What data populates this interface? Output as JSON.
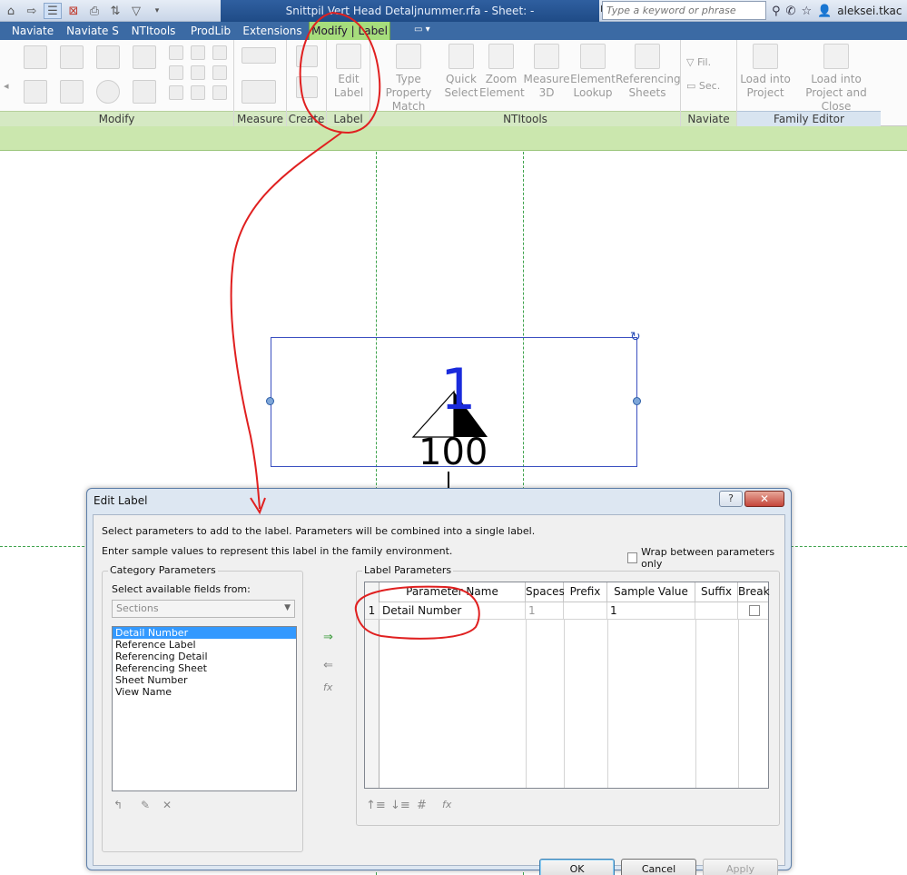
{
  "title_bar": {
    "doc_title": "Snittpil Vert Head Detaljnummer.rfa - Sheet: -",
    "search_placeholder": "Type a keyword or phrase",
    "username": "aleksei.tkac",
    "icons": [
      "home-icon",
      "forward-icon",
      "active-view-icon",
      "close-windows-icon",
      "print-icon",
      "sync-icon",
      "filter-icon",
      "dropdown-icon",
      "binoculars-icon",
      "satellite-icon",
      "star-icon",
      "user-icon"
    ]
  },
  "tabs": [
    {
      "label": "Naviate"
    },
    {
      "label": "Naviate S"
    },
    {
      "label": "NTItools"
    },
    {
      "label": "ProdLib"
    },
    {
      "label": "Extensions"
    },
    {
      "label": "Modify | Label"
    }
  ],
  "ribbon": {
    "panels": {
      "modify": "Modify",
      "measure": "Measure",
      "create": "Create",
      "label": "Label",
      "ntitools": "NTItools",
      "naviate": "Naviate",
      "family_editor": "Family Editor"
    },
    "buttons": {
      "edit_label": [
        "Edit",
        "Label"
      ],
      "type_property": [
        "Type Property",
        "Match"
      ],
      "quick_select": [
        "Quick",
        "Select"
      ],
      "zoom_element": [
        "Zoom",
        "Element"
      ],
      "measure_3d": [
        "Measure",
        "3D"
      ],
      "element_lookup": [
        "Element",
        "Lookup"
      ],
      "referencing_sheets": [
        "Referencing",
        "Sheets"
      ],
      "fil": "Fil.",
      "sec": "Sec.",
      "load_into_project": [
        "Load into",
        "Project"
      ],
      "load_into_close": [
        "Load into",
        "Project and Close"
      ]
    }
  },
  "canvas": {
    "label_number": "1",
    "label_scale": "100"
  },
  "dialog": {
    "title": "Edit Label",
    "help": "?",
    "close": "✕",
    "intro1": "Select parameters to add to the label.  Parameters will be combined into a single label.",
    "intro2": "Enter sample values to represent this label in the family environment.",
    "wrap_label": "Wrap between parameters only",
    "category_params": {
      "title": "Category Parameters",
      "select_label": "Select available fields from:",
      "dropdown_value": "Sections",
      "fields": [
        "Detail Number",
        "Reference Label",
        "Referencing Detail",
        "Referencing Sheet",
        "Sheet Number",
        "View Name"
      ]
    },
    "label_params": {
      "title": "Label Parameters",
      "headers": [
        "Parameter Name",
        "Spaces",
        "Prefix",
        "Sample Value",
        "Suffix",
        "Break"
      ],
      "rows": [
        {
          "num": "1",
          "name": "Detail Number",
          "spaces": "1",
          "prefix": "",
          "sample": "1",
          "suffix": ""
        }
      ]
    },
    "mid_buttons": {
      "add": "⇒",
      "remove": "⇐",
      "fx": "fx"
    },
    "buttons": {
      "ok": "OK",
      "cancel": "Cancel",
      "apply": "Apply"
    }
  }
}
